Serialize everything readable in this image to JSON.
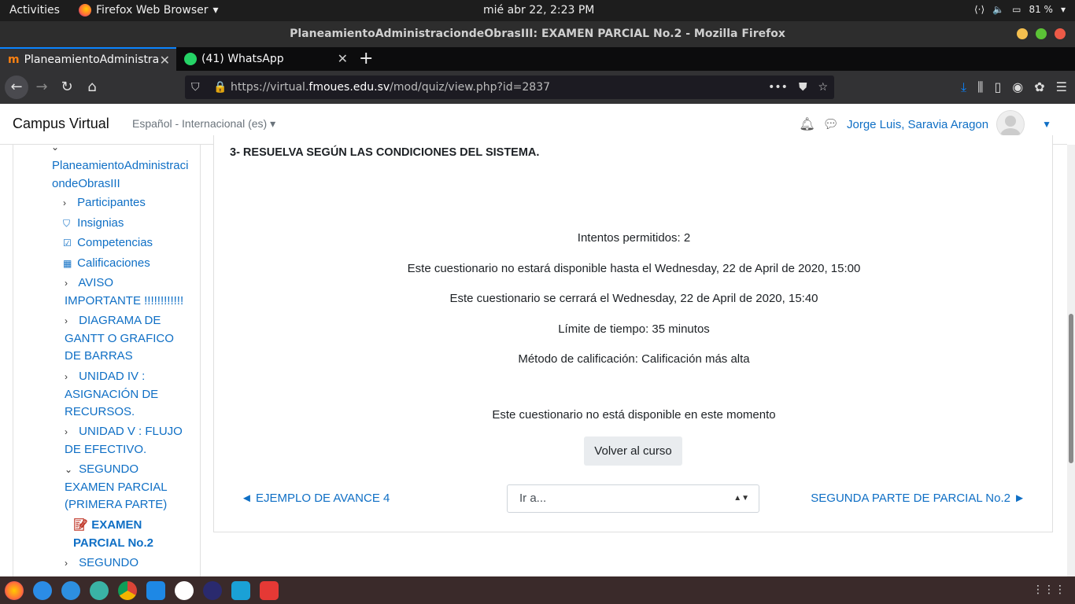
{
  "topbar": {
    "activities": "Activities",
    "app_name": "Firefox Web Browser",
    "clock": "mié abr 22,  2:23 PM",
    "battery": "81 %"
  },
  "window": {
    "title": "PlaneamientoAdministraciondeObrasIII: EXAMEN PARCIAL No.2 - Mozilla Firefox"
  },
  "tabs": [
    {
      "label": "PlaneamientoAdministra"
    },
    {
      "label": "(41) WhatsApp"
    }
  ],
  "url": {
    "prefix": "https://virtual.",
    "host": "fmoues.edu.sv",
    "path": "/mod/quiz/view.php?id=2837"
  },
  "header": {
    "brand": "Campus Virtual",
    "language": "Español - Internacional (es)",
    "user": "Jorge Luis, Saravia Aragon"
  },
  "drawer": {
    "course": "PlaneamientoAdministraciondeObrasIII",
    "items": [
      {
        "label": "Participantes"
      },
      {
        "label": "Insignias"
      },
      {
        "label": "Competencias"
      },
      {
        "label": "Calificaciones"
      },
      {
        "label": "AVISO IMPORTANTE !!!!!!!!!!!!"
      },
      {
        "label": "DIAGRAMA DE GANTT O GRAFICO DE BARRAS"
      },
      {
        "label": "UNIDAD IV : ASIGNACIÓN DE RECURSOS."
      },
      {
        "label": "UNIDAD V : FLUJO DE EFECTIVO."
      },
      {
        "label": "SEGUNDO EXAMEN PARCIAL (PRIMERA PARTE)"
      },
      {
        "label": "EXAMEN PARCIAL No.2"
      },
      {
        "label": "SEGUNDO"
      }
    ]
  },
  "quiz": {
    "question": "3- RESUELVA SEGÚN LAS CONDICIONES DEL SISTEMA.",
    "attempts": "Intentos permitidos: 2",
    "opens": "Este cuestionario no estará disponible hasta el Wednesday, 22 de April de 2020, 15:00",
    "closes": "Este cuestionario se cerrará el Wednesday, 22 de April de 2020, 15:40",
    "time_limit": "Límite de tiempo: 35 minutos",
    "grading": "Método de calificación: Calificación más alta",
    "unavailable": "Este cuestionario no está disponible en este momento",
    "back_button": "Volver al curso",
    "prev_link": "◄ EJEMPLO DE AVANCE 4",
    "jump_select": "Ir a...",
    "next_link": "SEGUNDA PARTE DE PARCIAL No.2 ►"
  },
  "colors": {
    "link": "#0f6fc5",
    "firefox_accent": "#0a84ff"
  }
}
